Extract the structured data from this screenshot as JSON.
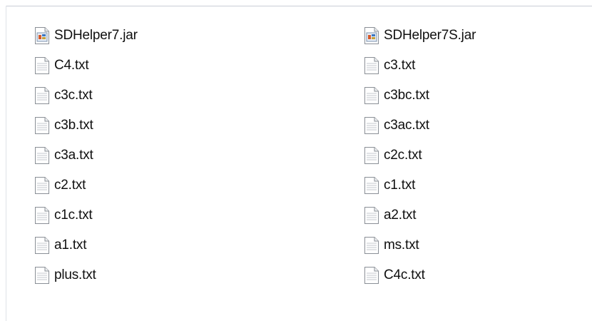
{
  "files": {
    "left": [
      {
        "name": "SDHelper7.jar",
        "icon": "jar-file-icon"
      },
      {
        "name": "C4.txt",
        "icon": "text-file-icon"
      },
      {
        "name": "c3c.txt",
        "icon": "text-file-icon"
      },
      {
        "name": "c3b.txt",
        "icon": "text-file-icon"
      },
      {
        "name": "c3a.txt",
        "icon": "text-file-icon"
      },
      {
        "name": "c2.txt",
        "icon": "text-file-icon"
      },
      {
        "name": "c1c.txt",
        "icon": "text-file-icon"
      },
      {
        "name": "a1.txt",
        "icon": "text-file-icon"
      },
      {
        "name": "plus.txt",
        "icon": "text-file-icon"
      }
    ],
    "right": [
      {
        "name": "SDHelper7S.jar",
        "icon": "jar-file-icon"
      },
      {
        "name": "c3.txt",
        "icon": "text-file-icon"
      },
      {
        "name": "c3bc.txt",
        "icon": "text-file-icon"
      },
      {
        "name": "c3ac.txt",
        "icon": "text-file-icon"
      },
      {
        "name": "c2c.txt",
        "icon": "text-file-icon"
      },
      {
        "name": "c1.txt",
        "icon": "text-file-icon"
      },
      {
        "name": "a2.txt",
        "icon": "text-file-icon"
      },
      {
        "name": "ms.txt",
        "icon": "text-file-icon"
      },
      {
        "name": "C4c.txt",
        "icon": "text-file-icon"
      }
    ]
  }
}
